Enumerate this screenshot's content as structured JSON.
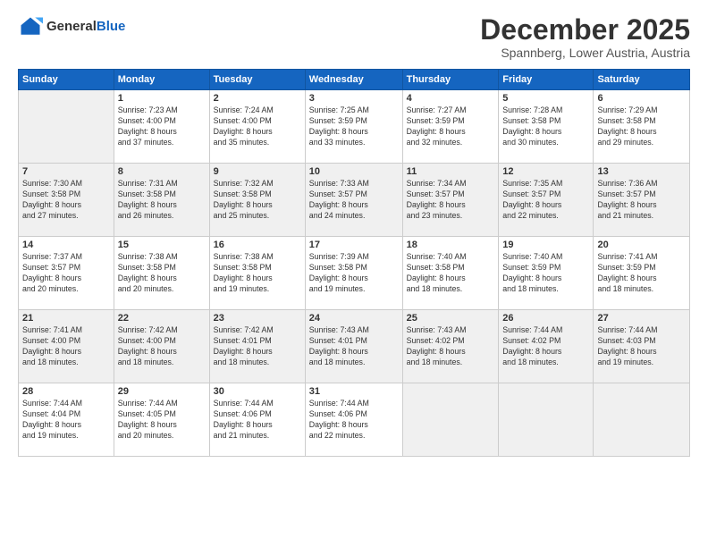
{
  "logo": {
    "line1": "General",
    "line2": "Blue"
  },
  "title": "December 2025",
  "location": "Spannberg, Lower Austria, Austria",
  "days_header": [
    "Sunday",
    "Monday",
    "Tuesday",
    "Wednesday",
    "Thursday",
    "Friday",
    "Saturday"
  ],
  "weeks": [
    [
      {
        "num": "",
        "empty": true
      },
      {
        "num": "1",
        "sunrise": "7:23 AM",
        "sunset": "4:00 PM",
        "daylight": "8 hours and 37 minutes."
      },
      {
        "num": "2",
        "sunrise": "7:24 AM",
        "sunset": "4:00 PM",
        "daylight": "8 hours and 35 minutes."
      },
      {
        "num": "3",
        "sunrise": "7:25 AM",
        "sunset": "3:59 PM",
        "daylight": "8 hours and 33 minutes."
      },
      {
        "num": "4",
        "sunrise": "7:27 AM",
        "sunset": "3:59 PM",
        "daylight": "8 hours and 32 minutes."
      },
      {
        "num": "5",
        "sunrise": "7:28 AM",
        "sunset": "3:58 PM",
        "daylight": "8 hours and 30 minutes."
      },
      {
        "num": "6",
        "sunrise": "7:29 AM",
        "sunset": "3:58 PM",
        "daylight": "8 hours and 29 minutes."
      }
    ],
    [
      {
        "num": "7",
        "sunrise": "7:30 AM",
        "sunset": "3:58 PM",
        "daylight": "8 hours and 27 minutes."
      },
      {
        "num": "8",
        "sunrise": "7:31 AM",
        "sunset": "3:58 PM",
        "daylight": "8 hours and 26 minutes."
      },
      {
        "num": "9",
        "sunrise": "7:32 AM",
        "sunset": "3:58 PM",
        "daylight": "8 hours and 25 minutes."
      },
      {
        "num": "10",
        "sunrise": "7:33 AM",
        "sunset": "3:57 PM",
        "daylight": "8 hours and 24 minutes."
      },
      {
        "num": "11",
        "sunrise": "7:34 AM",
        "sunset": "3:57 PM",
        "daylight": "8 hours and 23 minutes."
      },
      {
        "num": "12",
        "sunrise": "7:35 AM",
        "sunset": "3:57 PM",
        "daylight": "8 hours and 22 minutes."
      },
      {
        "num": "13",
        "sunrise": "7:36 AM",
        "sunset": "3:57 PM",
        "daylight": "8 hours and 21 minutes."
      }
    ],
    [
      {
        "num": "14",
        "sunrise": "7:37 AM",
        "sunset": "3:57 PM",
        "daylight": "8 hours and 20 minutes."
      },
      {
        "num": "15",
        "sunrise": "7:38 AM",
        "sunset": "3:58 PM",
        "daylight": "8 hours and 20 minutes."
      },
      {
        "num": "16",
        "sunrise": "7:38 AM",
        "sunset": "3:58 PM",
        "daylight": "8 hours and 19 minutes."
      },
      {
        "num": "17",
        "sunrise": "7:39 AM",
        "sunset": "3:58 PM",
        "daylight": "8 hours and 19 minutes."
      },
      {
        "num": "18",
        "sunrise": "7:40 AM",
        "sunset": "3:58 PM",
        "daylight": "8 hours and 18 minutes."
      },
      {
        "num": "19",
        "sunrise": "7:40 AM",
        "sunset": "3:59 PM",
        "daylight": "8 hours and 18 minutes."
      },
      {
        "num": "20",
        "sunrise": "7:41 AM",
        "sunset": "3:59 PM",
        "daylight": "8 hours and 18 minutes."
      }
    ],
    [
      {
        "num": "21",
        "sunrise": "7:41 AM",
        "sunset": "4:00 PM",
        "daylight": "8 hours and 18 minutes."
      },
      {
        "num": "22",
        "sunrise": "7:42 AM",
        "sunset": "4:00 PM",
        "daylight": "8 hours and 18 minutes."
      },
      {
        "num": "23",
        "sunrise": "7:42 AM",
        "sunset": "4:01 PM",
        "daylight": "8 hours and 18 minutes."
      },
      {
        "num": "24",
        "sunrise": "7:43 AM",
        "sunset": "4:01 PM",
        "daylight": "8 hours and 18 minutes."
      },
      {
        "num": "25",
        "sunrise": "7:43 AM",
        "sunset": "4:02 PM",
        "daylight": "8 hours and 18 minutes."
      },
      {
        "num": "26",
        "sunrise": "7:44 AM",
        "sunset": "4:02 PM",
        "daylight": "8 hours and 18 minutes."
      },
      {
        "num": "27",
        "sunrise": "7:44 AM",
        "sunset": "4:03 PM",
        "daylight": "8 hours and 19 minutes."
      }
    ],
    [
      {
        "num": "28",
        "sunrise": "7:44 AM",
        "sunset": "4:04 PM",
        "daylight": "8 hours and 19 minutes."
      },
      {
        "num": "29",
        "sunrise": "7:44 AM",
        "sunset": "4:05 PM",
        "daylight": "8 hours and 20 minutes."
      },
      {
        "num": "30",
        "sunrise": "7:44 AM",
        "sunset": "4:06 PM",
        "daylight": "8 hours and 21 minutes."
      },
      {
        "num": "31",
        "sunrise": "7:44 AM",
        "sunset": "4:06 PM",
        "daylight": "8 hours and 22 minutes."
      },
      {
        "num": "",
        "empty": true
      },
      {
        "num": "",
        "empty": true
      },
      {
        "num": "",
        "empty": true
      }
    ]
  ]
}
